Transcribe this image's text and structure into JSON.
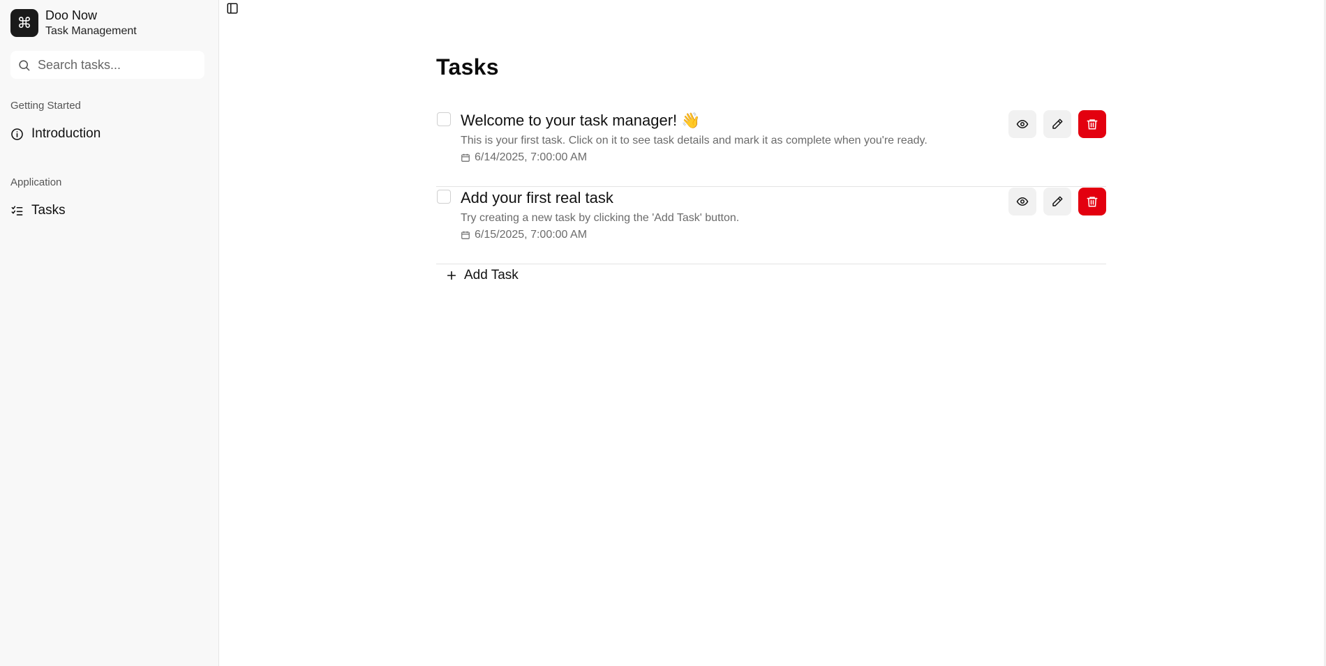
{
  "app": {
    "name": "Doo Now",
    "subtitle": "Task Management",
    "logo_glyph": "⌘"
  },
  "sidebar": {
    "search_placeholder": "Search tasks...",
    "groups": [
      {
        "label": "Getting Started",
        "items": [
          {
            "label": "Introduction",
            "icon": "info-icon"
          }
        ]
      },
      {
        "label": "Application",
        "items": [
          {
            "label": "Tasks",
            "icon": "list-checks-icon"
          }
        ]
      }
    ]
  },
  "main": {
    "title": "Tasks",
    "tasks": [
      {
        "title": "Welcome to your task manager! 👋",
        "description": "This is your first task. Click on it to see task details and mark it as complete when you're ready.",
        "date": "6/14/2025, 7:00:00 AM",
        "completed": false
      },
      {
        "title": "Add your first real task",
        "description": "Try creating a new task by clicking the 'Add Task' button.",
        "date": "6/15/2025, 7:00:00 AM",
        "completed": false
      }
    ],
    "add_task_label": "Add Task"
  },
  "colors": {
    "delete_button": "#e3000f",
    "sidebar_bg": "#f8f8f8",
    "logo_bg": "#1a1a1a"
  }
}
